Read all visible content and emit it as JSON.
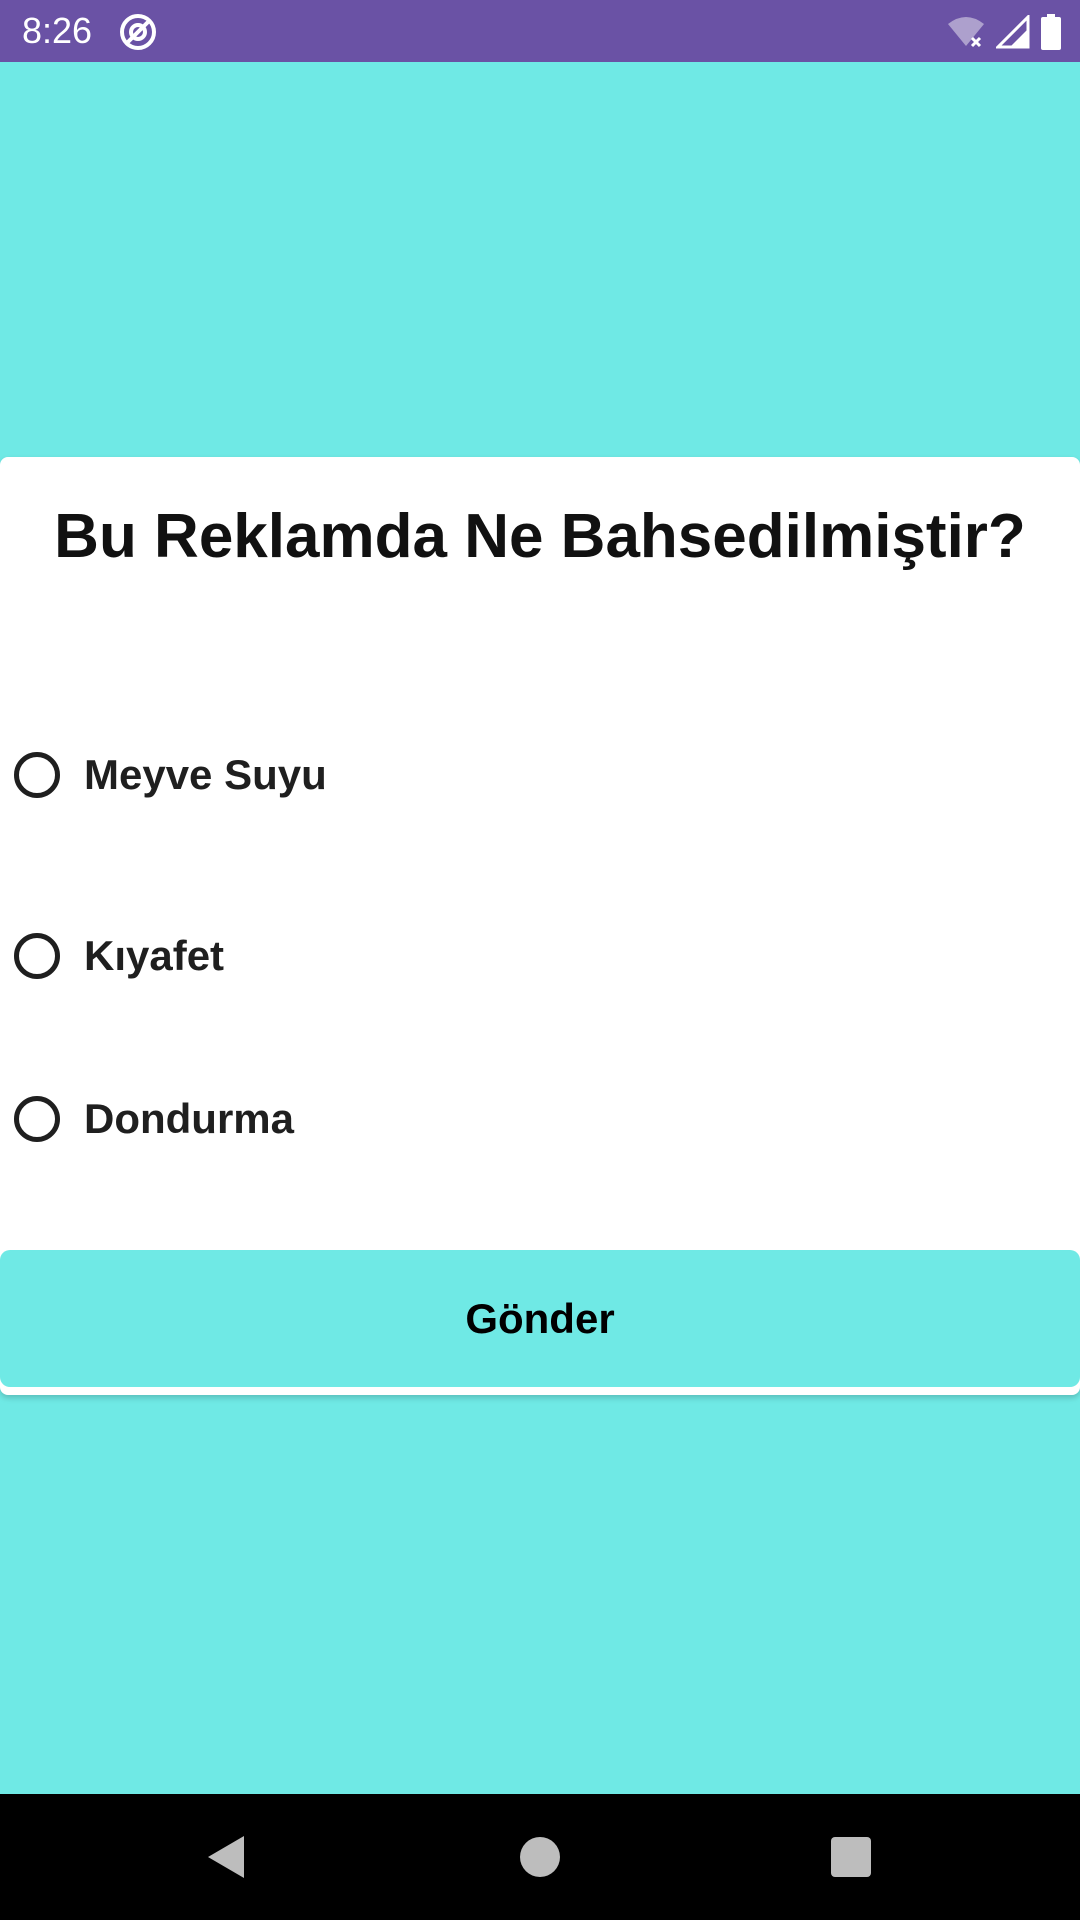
{
  "status_bar": {
    "time": "8:26",
    "icons": [
      "at-sign-icon",
      "wifi-off-icon",
      "signal-icon",
      "battery-icon"
    ]
  },
  "quiz": {
    "question": "Bu Reklamda Ne Bahsedilmiştir?",
    "options": [
      {
        "label": "Meyve Suyu",
        "selected": false
      },
      {
        "label": "Kıyafet",
        "selected": false
      },
      {
        "label": "Dondurma",
        "selected": false
      }
    ],
    "submit_label": "Gönder"
  },
  "navigation": {
    "buttons": [
      "back-icon",
      "home-icon",
      "recents-icon"
    ]
  },
  "colors": {
    "status_bar": "#6A52A5",
    "background": "#6FE9E5",
    "card": "#FFFFFF",
    "button": "#6FE9E5",
    "nav_bar": "#000000"
  }
}
